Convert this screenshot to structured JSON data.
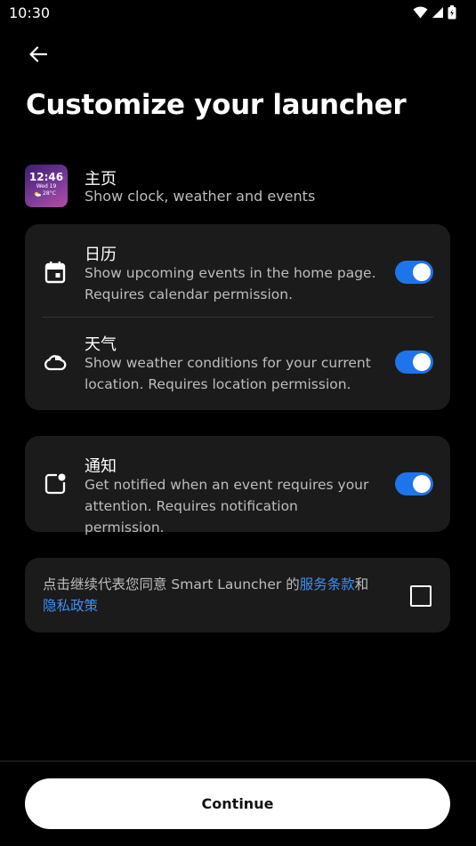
{
  "status": {
    "time": "10:30"
  },
  "page": {
    "title": "Customize your launcher"
  },
  "home": {
    "title": "主页",
    "subtitle": "Show clock, weather and events",
    "preview": {
      "time": "12:46",
      "date": "Wed 19",
      "temp": "28°C"
    }
  },
  "settings": [
    {
      "title": "日历",
      "subtitle": "Show upcoming events in the home page. Requires calendar permission.",
      "icon": "calendar-icon",
      "enabled": true
    },
    {
      "title": "天气",
      "subtitle": "Show weather conditions for your current location. Requires location permission.",
      "icon": "cloud-icon",
      "enabled": true
    },
    {
      "title": "通知",
      "subtitle": "Get notified when an event requires your attention. Requires notification permission.",
      "icon": "notification-icon",
      "enabled": true
    }
  ],
  "consent": {
    "prefix": "点击继续代表您同意 Smart Launcher 的",
    "terms_link": "服务条款",
    "and": "和",
    "privacy_link": "隐私政策",
    "checked": false
  },
  "footer": {
    "continue_label": "Continue"
  },
  "colors": {
    "background": "#000000",
    "card": "#1b1b1b",
    "accent": "#1e74ea",
    "link": "#3f8ef5"
  }
}
